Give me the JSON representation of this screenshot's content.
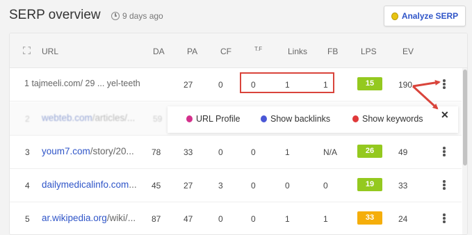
{
  "header": {
    "title": "SERP overview",
    "time_ago": "9 days ago",
    "analyze_button": "Analyze SERP"
  },
  "table": {
    "columns": [
      "URL",
      "DA",
      "PA",
      "CF",
      "T.F",
      "Links",
      "FB",
      "LPS",
      "EV"
    ],
    "rows": [
      {
        "num": "1",
        "domain": "",
        "path": "tajmeeli.com/ 29 ... yel-teeth",
        "da": "",
        "pa": "27",
        "cf": "0",
        "tf": "0",
        "links": "1",
        "fb": "1",
        "lps": "15",
        "lps_color": "#94c91f",
        "ev": "190"
      },
      {
        "num": "3",
        "domain": "youm7.com",
        "path": "/story/20...",
        "da": "78",
        "pa": "33",
        "cf": "0",
        "tf": "0",
        "links": "1",
        "fb": "N/A",
        "lps": "26",
        "lps_color": "#94c91f",
        "ev": "49"
      },
      {
        "num": "4",
        "domain": "dailymedicalinfo.com",
        "path": "...",
        "da": "45",
        "pa": "27",
        "cf": "3",
        "tf": "0",
        "links": "0",
        "fb": "0",
        "lps": "19",
        "lps_color": "#94c91f",
        "ev": "33"
      },
      {
        "num": "5",
        "domain": "ar.wikipedia.org",
        "path": "/wiki/...",
        "da": "87",
        "pa": "47",
        "cf": "0",
        "tf": "0",
        "links": "1",
        "fb": "1",
        "lps": "33",
        "lps_color": "#f5ae0b",
        "ev": "24"
      }
    ],
    "popup_row": {
      "num": "2",
      "domain": "webteb.com",
      "path": "/articles/...",
      "da": "59"
    }
  },
  "menu": {
    "url_profile": "URL Profile",
    "show_backlinks": "Show backlinks",
    "show_keywords": "Show keywords",
    "close": "✕",
    "url_profile_color": "#d4308c",
    "show_backlinks_color": "#4a57d6",
    "show_keywords_color": "#e0393a"
  },
  "colors": {
    "link": "#2f55c8",
    "annotation": "#d9443b"
  }
}
